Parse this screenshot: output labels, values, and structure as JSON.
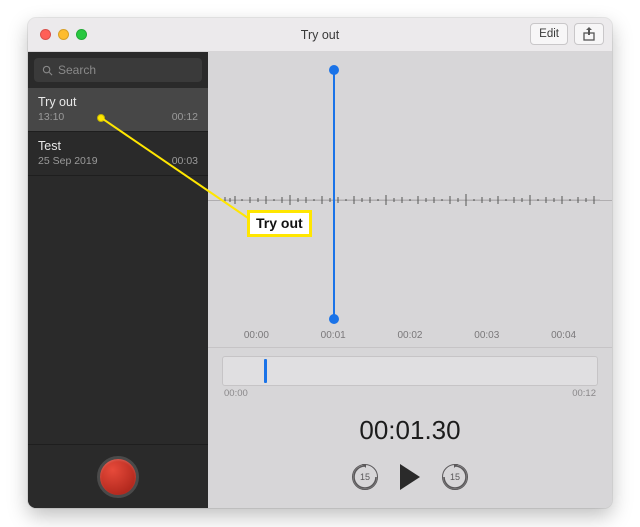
{
  "window": {
    "title": "Try out",
    "edit_label": "Edit"
  },
  "search": {
    "placeholder": "Search"
  },
  "recordings": [
    {
      "name": "Try out",
      "date": "13:10",
      "duration": "00:12",
      "selected": true
    },
    {
      "name": "Test",
      "date": "25 Sep 2019",
      "duration": "00:03",
      "selected": false
    }
  ],
  "timeline": {
    "ticks": [
      "00:00",
      "00:01",
      "00:02",
      "00:03",
      "00:04"
    ],
    "playhead_fraction": 0.31
  },
  "mini": {
    "start_label": "00:00",
    "end_label": "00:12",
    "playhead_fraction": 0.11
  },
  "playback": {
    "current_time": "00:01.30",
    "skip_seconds": "15"
  },
  "annotation": {
    "label": "Try out"
  }
}
